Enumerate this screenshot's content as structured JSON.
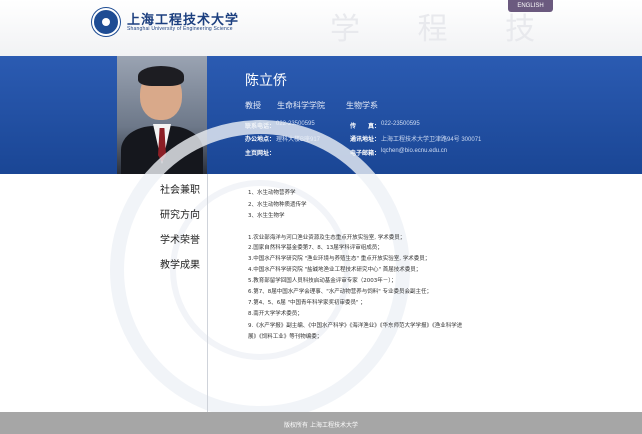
{
  "header": {
    "logo_cn": "上海工程技术大学",
    "logo_en": "Shanghai University of Engineering Science",
    "lang_button": "ENGLISH"
  },
  "profile": {
    "name": "陈立侨",
    "title": "教授",
    "college": "生命科学学院",
    "department": "生物学系",
    "phone_label": "联系电话：",
    "phone": "022-23500595",
    "fax_label": "传　　真：",
    "fax": "022-23500595",
    "office_label": "办公地点：",
    "office": "理科大楼B座917",
    "address_label": "通讯地址：",
    "address": "上海工程技术大学卫津路94号 300071",
    "homepage_label": "主页网址：",
    "homepage": "",
    "email_label": "电子邮箱：",
    "email": "lqchen@bio.ecnu.edu.cn"
  },
  "nav": [
    {
      "label": "社会兼职"
    },
    {
      "label": "研究方向"
    },
    {
      "label": "学术荣誉"
    },
    {
      "label": "教学成果"
    }
  ],
  "content": {
    "research": [
      "1、水生动物营养学",
      "2、水生动物种质遗传学",
      "3、水生生物学"
    ],
    "positions": [
      "1.农业部海洋与河口渔业资源及生态重点开放实验室, 学术委员；",
      "2.国家自然科学基金委第7、8、13届学科评审组成员；",
      "3.中国水产科学研究院 \"渔业环境与养殖生态\" 重点开放实验室, 学术委员；",
      "4.中国水产科学研究院 \"盐碱地渔业工程技术研究中心\" 首届技术委员；",
      "5.教育部留学回国人员科技启动基金评审专家（2003年－）；",
      "6.第7、8届中国水产学会理事、\"水产动物营养与饲料\" 专业委员会副主任；",
      "7.第4、5、6届 \"中国青年科学家奖初审委员\" ；",
      "8.南开大学学术委员；",
      "9.《水产学报》副主编、《中国水产科学》《海洋渔业》《华东师范大学学报》《渔业科学进",
      "展》《饲料工业》等刊物编委；"
    ]
  },
  "footer": {
    "text": "版权所有  上海工程技术大学"
  }
}
